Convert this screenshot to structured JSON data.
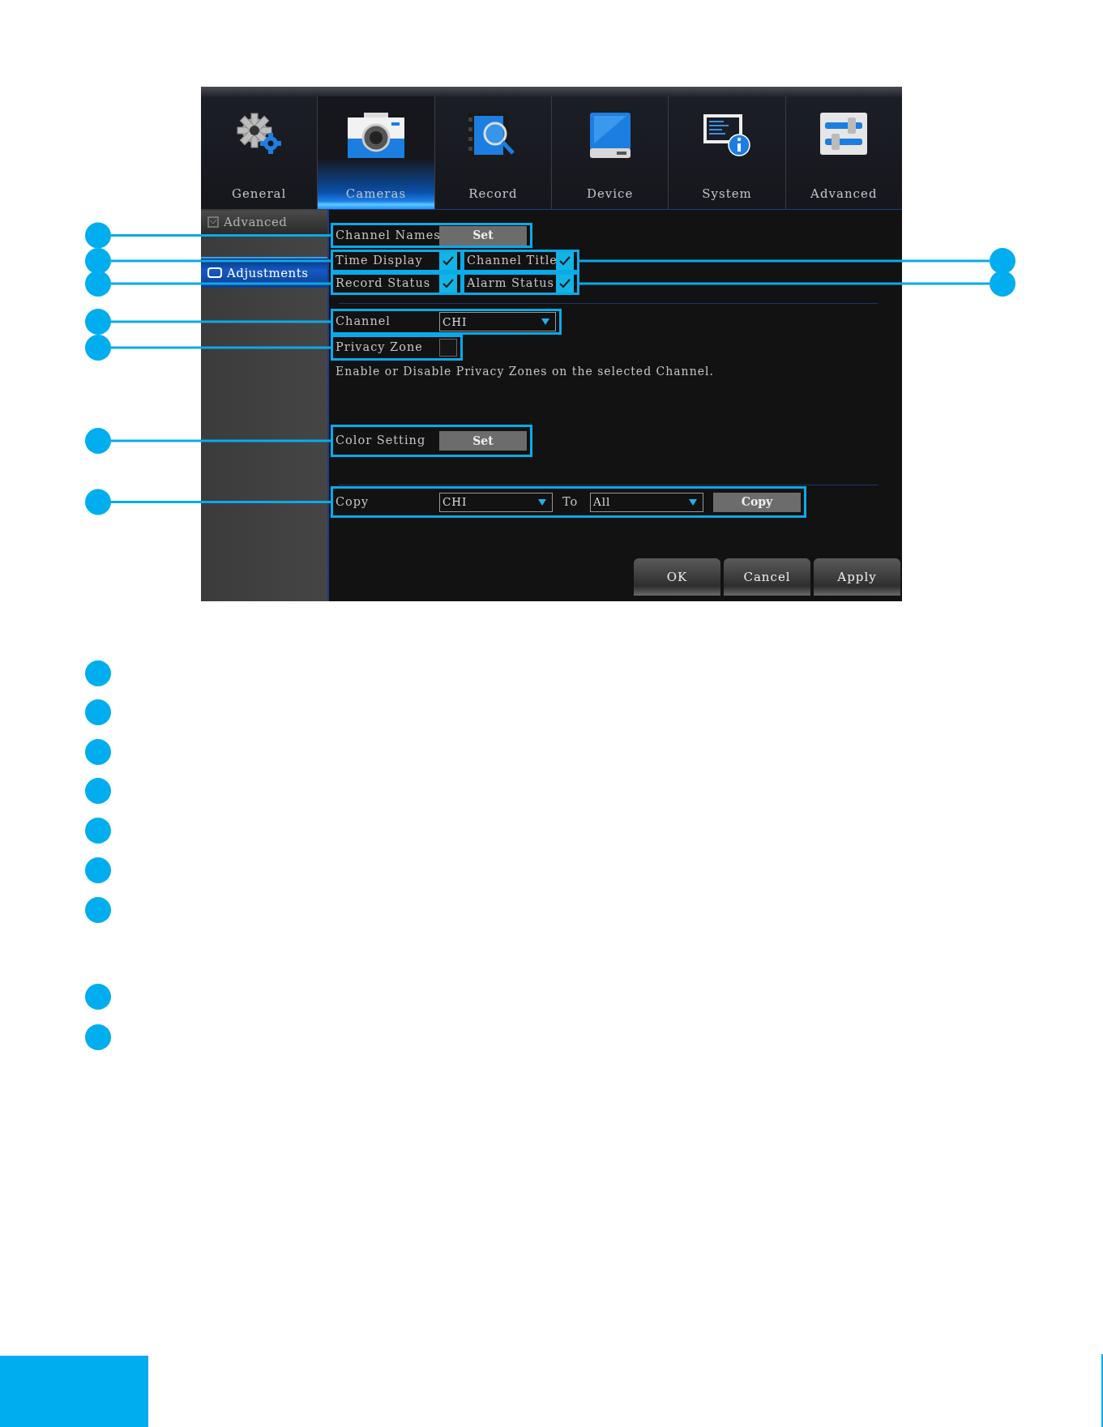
{
  "tabs": [
    {
      "label": "General",
      "selected": false
    },
    {
      "label": "Cameras",
      "selected": true
    },
    {
      "label": "Record",
      "selected": false
    },
    {
      "label": "Device",
      "selected": false
    },
    {
      "label": "System",
      "selected": false
    },
    {
      "label": "Advanced",
      "selected": false
    }
  ],
  "sidebar": {
    "items": [
      {
        "label": "Advanced",
        "selected": false
      },
      {
        "label": "Adjustments",
        "selected": true
      }
    ]
  },
  "channel_names": {
    "label": "Channel Names",
    "button": "Set",
    "callout": true
  },
  "overlay_checks": [
    {
      "label": "Time Display",
      "checked": true,
      "callout": true
    },
    {
      "label": "Channel Title",
      "checked": true,
      "callout": true
    },
    {
      "label": "Record Status",
      "checked": true,
      "callout": true
    },
    {
      "label": "Alarm Status",
      "checked": true,
      "callout": true
    }
  ],
  "channel": {
    "label": "Channel",
    "value": "CHI",
    "callout": true
  },
  "privacy_zone": {
    "label": "Privacy Zone",
    "checked": false,
    "callout": true
  },
  "description": "Enable or Disable Privacy Zones on the selected Channel.",
  "color_setting": {
    "label": "Color Setting",
    "button": "Set",
    "callout": true
  },
  "copy": {
    "label": "Copy",
    "from": "CHI",
    "to_label": "To",
    "to": "All",
    "button": "Copy",
    "callout": true
  },
  "buttons": [
    "OK",
    "Cancel",
    "Apply"
  ]
}
